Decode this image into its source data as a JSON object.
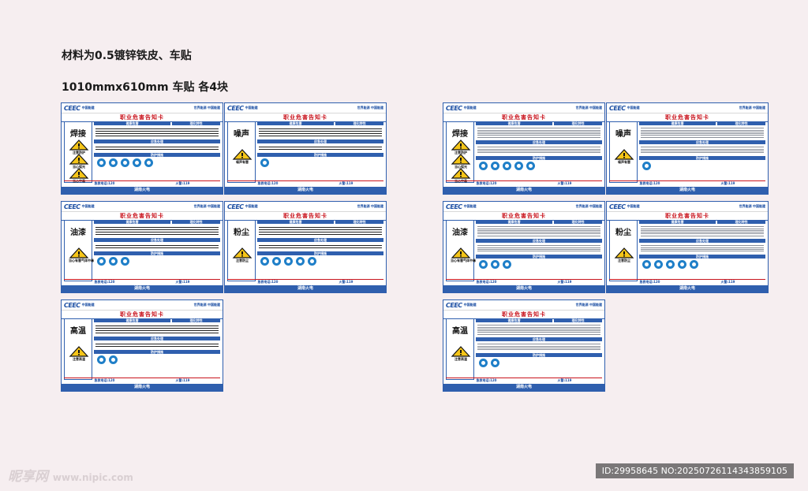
{
  "headings": {
    "material": "材料为0.5镀锌铁皮、车贴",
    "size": "1010mmx610mm  车贴 各4块"
  },
  "card_common": {
    "logo_mark": "CEEC",
    "logo_text": "中国能建",
    "slogan": "世界能源  中国能建",
    "title": "职业危害告知卡",
    "sec_health": "健康危害",
    "sec_props": "理化特性",
    "sec_emergency": "应急处理",
    "sec_protect": "防护措施",
    "phone_emergency": "急救电话:120",
    "phone_fire": "火警:119",
    "footer": "湖南火电"
  },
  "left_cards": [
    {
      "hazard": "焊接",
      "warnings": [
        "注意防护",
        "当心弧光",
        "当心中毒"
      ]
    },
    {
      "hazard": "噪声",
      "warnings": [
        "噪声有害"
      ]
    },
    {
      "hazard": "油漆",
      "warnings": [
        "当心有害气体中毒"
      ]
    },
    {
      "hazard": "粉尘",
      "warnings": [
        "注意防尘"
      ]
    },
    {
      "hazard": "高温",
      "warnings": [
        "注意高温"
      ]
    }
  ],
  "right_cards": [
    {
      "hazard": "焊接",
      "warnings": [
        "注意防护",
        "当心弧光",
        "当心中毒"
      ]
    },
    {
      "hazard": "噪声",
      "warnings": [
        "噪声有害"
      ]
    },
    {
      "hazard": "油漆",
      "warnings": [
        "当心有害气体中毒"
      ]
    },
    {
      "hazard": "粉尘",
      "warnings": [
        "注意防尘"
      ]
    },
    {
      "hazard": "高温",
      "warnings": [
        "注意高温"
      ]
    }
  ],
  "watermark": {
    "brand": "昵享网",
    "url": "www.nipic.com"
  },
  "id_text": "ID:29958645 NO:20250726114343859105",
  "colors": {
    "accent_blue": "#2f5fae",
    "title_red": "#c9151e",
    "icon_blue": "#1f7fc8"
  }
}
